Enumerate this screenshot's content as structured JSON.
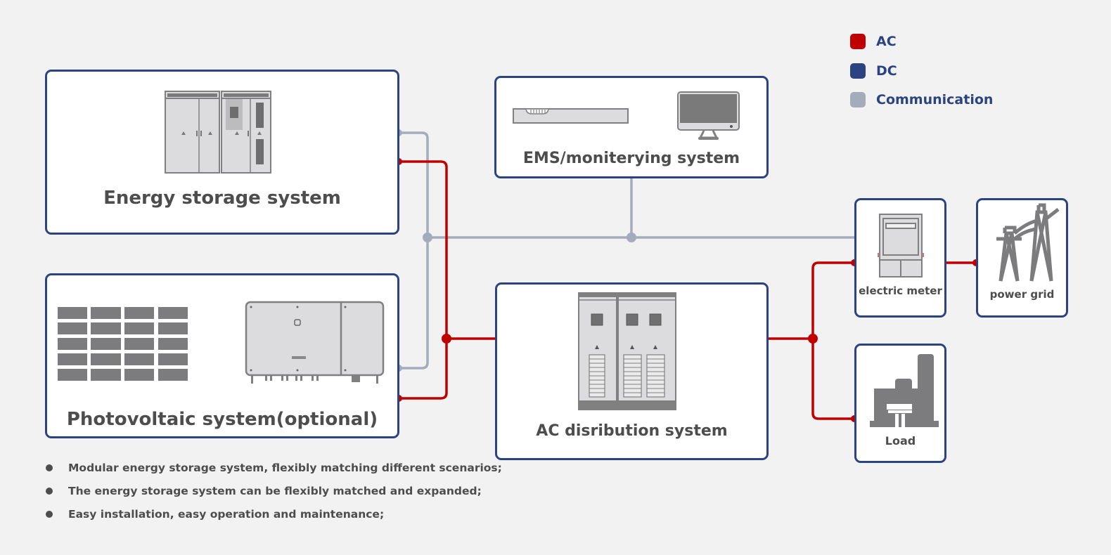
{
  "legend": {
    "items": [
      {
        "label": "AC",
        "color": "#c00000"
      },
      {
        "label": "DC",
        "color": "#2b4481"
      },
      {
        "label": "Communication",
        "color": "#a4abba"
      }
    ]
  },
  "nodes": {
    "energy_storage": {
      "title": "Energy storage system",
      "icon": "battery-cabinet-icon"
    },
    "ems": {
      "title": "EMS/moniterying system",
      "icons": [
        "controller-unit-icon",
        "monitor-icon"
      ]
    },
    "photovoltaic": {
      "title": "Photovoltaic system(optional)",
      "icons": [
        "solar-panel-array-icon",
        "inverter-icon"
      ]
    },
    "ac_distribution": {
      "title": "AC disribution system",
      "icon": "distribution-cabinet-icon"
    },
    "electric_meter": {
      "title": "electric meter",
      "icon": "electric-meter-icon"
    },
    "power_grid": {
      "title": "power grid",
      "icon": "transmission-tower-icon"
    },
    "load": {
      "title": "Load",
      "icon": "factory-icon"
    }
  },
  "connections": [
    {
      "from": "energy_storage",
      "to": "ems",
      "type": "Communication"
    },
    {
      "from": "photovoltaic",
      "to": "ems",
      "type": "Communication"
    },
    {
      "from": "electric_meter",
      "to": "ems",
      "type": "Communication"
    },
    {
      "from": "energy_storage",
      "to": "ac_distribution",
      "type": "AC"
    },
    {
      "from": "photovoltaic",
      "to": "ac_distribution",
      "type": "AC"
    },
    {
      "from": "ac_distribution",
      "to": "electric_meter",
      "type": "AC"
    },
    {
      "from": "ac_distribution",
      "to": "load",
      "type": "AC"
    },
    {
      "from": "electric_meter",
      "to": "power_grid",
      "type": "AC"
    }
  ],
  "features": [
    "Modular energy storage system, flexibly matching different scenarios;",
    "The energy storage system can be flexibly matched and expanded;",
    "Easy installation, easy operation and maintenance;"
  ]
}
